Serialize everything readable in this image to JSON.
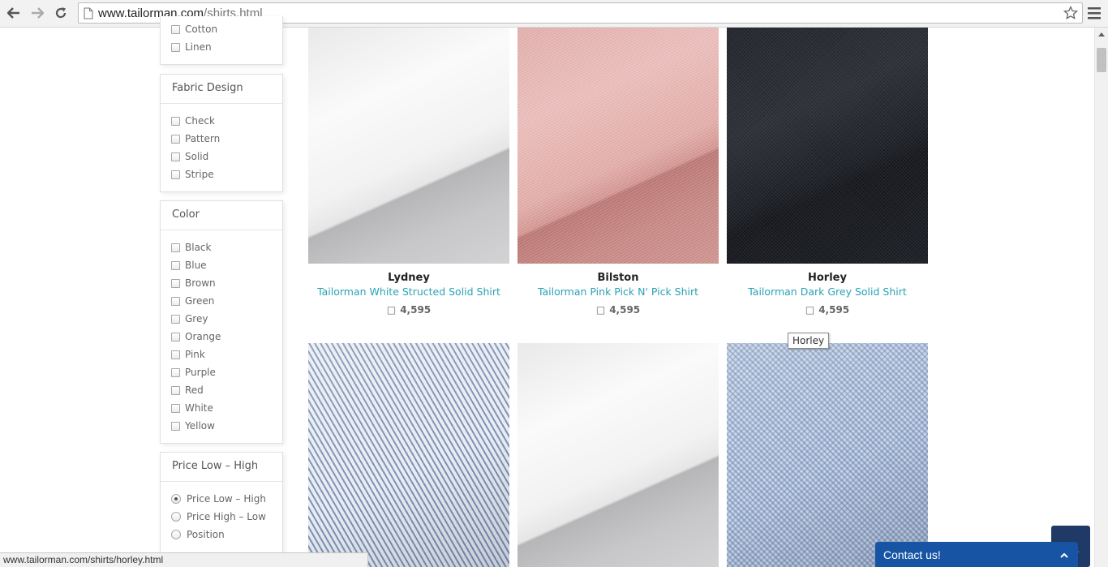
{
  "browser": {
    "url_host": "www.tailorman.com",
    "url_path": "/shirts.html",
    "status_url": "www.tailorman.com/shirts/horley.html"
  },
  "filters": {
    "material": {
      "items": [
        {
          "label": "Cotton",
          "checked": false
        },
        {
          "label": "Linen",
          "checked": false
        }
      ]
    },
    "fabric_design": {
      "title": "Fabric Design",
      "items": [
        {
          "label": "Check",
          "checked": false
        },
        {
          "label": "Pattern",
          "checked": false
        },
        {
          "label": "Solid",
          "checked": false
        },
        {
          "label": "Stripe",
          "checked": false
        }
      ]
    },
    "color": {
      "title": "Color",
      "items": [
        {
          "label": "Black",
          "checked": false
        },
        {
          "label": "Blue",
          "checked": false
        },
        {
          "label": "Brown",
          "checked": false
        },
        {
          "label": "Green",
          "checked": false
        },
        {
          "label": "Grey",
          "checked": false
        },
        {
          "label": "Orange",
          "checked": false
        },
        {
          "label": "Pink",
          "checked": false
        },
        {
          "label": "Purple",
          "checked": false
        },
        {
          "label": "Red",
          "checked": false
        },
        {
          "label": "White",
          "checked": false
        },
        {
          "label": "Yellow",
          "checked": false
        }
      ]
    },
    "sort": {
      "title": "Price Low – High",
      "selected": "Price Low – High",
      "options": [
        {
          "label": "Price Low – High",
          "checked": true
        },
        {
          "label": "Price High – Low",
          "checked": false
        },
        {
          "label": "Position",
          "checked": false
        }
      ]
    }
  },
  "products": [
    {
      "name": "Lydney",
      "description": "Tailorman White Structed Solid Shirt",
      "currency_symbol": "□",
      "price": "4,595",
      "fabric": "white"
    },
    {
      "name": "Bilston",
      "description": "Tailorman Pink Pick N' Pick Shirt",
      "currency_symbol": "□",
      "price": "4,595",
      "fabric": "pink"
    },
    {
      "name": "Horley",
      "description": "Tailorman Dark Grey Solid Shirt",
      "currency_symbol": "□",
      "price": "4,595",
      "fabric": "dark-grey"
    },
    {
      "fabric": "blue-stripe"
    },
    {
      "fabric": "white"
    },
    {
      "fabric": "blue-check"
    }
  ],
  "tooltip": "Horley",
  "contact": {
    "label": "Contact us!"
  },
  "colors": {
    "link": "#2aa3b5",
    "contact_bg": "#1754a3",
    "to_top_bg": "#1f3a66"
  }
}
